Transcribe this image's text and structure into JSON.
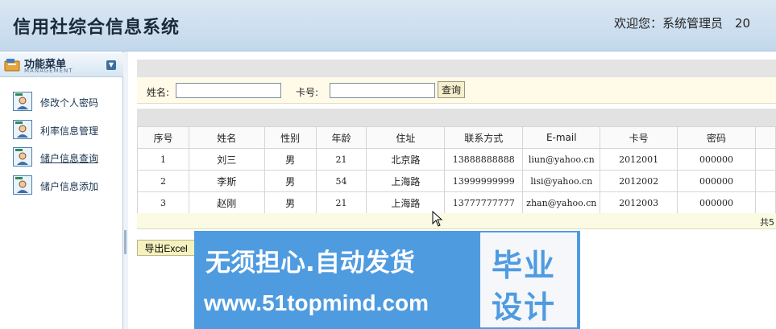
{
  "header": {
    "title": "信用社综合信息系统",
    "welcome": "欢迎您：系统管理员　20"
  },
  "sidebar": {
    "title": "功能菜单",
    "subtitle": "MANAGEMENT",
    "items": [
      {
        "label": "修改个人密码"
      },
      {
        "label": "利率信息管理"
      },
      {
        "label": "储户信息查询"
      },
      {
        "label": "储户信息添加"
      }
    ]
  },
  "search": {
    "name_label": "姓名:",
    "name_value": "",
    "card_label": "卡号:",
    "card_value": "",
    "query_label": "查询"
  },
  "table": {
    "headers": [
      "序号",
      "姓名",
      "性别",
      "年龄",
      "住址",
      "联系方式",
      "E-mail",
      "卡号",
      "密码",
      ""
    ],
    "rows": [
      [
        "1",
        "刘三",
        "男",
        "21",
        "北京路",
        "13888888888",
        "liun@yahoo.cn",
        "2012001",
        "000000",
        ""
      ],
      [
        "2",
        "李斯",
        "男",
        "54",
        "上海路",
        "13999999999",
        "lisi@yahoo.cn",
        "2012002",
        "000000",
        ""
      ],
      [
        "3",
        "赵刚",
        "男",
        "21",
        "上海路",
        "13777777777",
        "zhan@yahoo.cn",
        "2012003",
        "000000",
        ""
      ]
    ]
  },
  "pager": {
    "text": "共5"
  },
  "export_label": "导出Excel",
  "watermark": {
    "line1": "无须担心.自动发货",
    "line2": "www.51topmind.com",
    "box1": "毕业",
    "box2": "设计"
  },
  "colors": {
    "header_bg": "#c3d8ec",
    "watermark_bg": "#4f9be0",
    "search_bg": "#fffbe8"
  }
}
